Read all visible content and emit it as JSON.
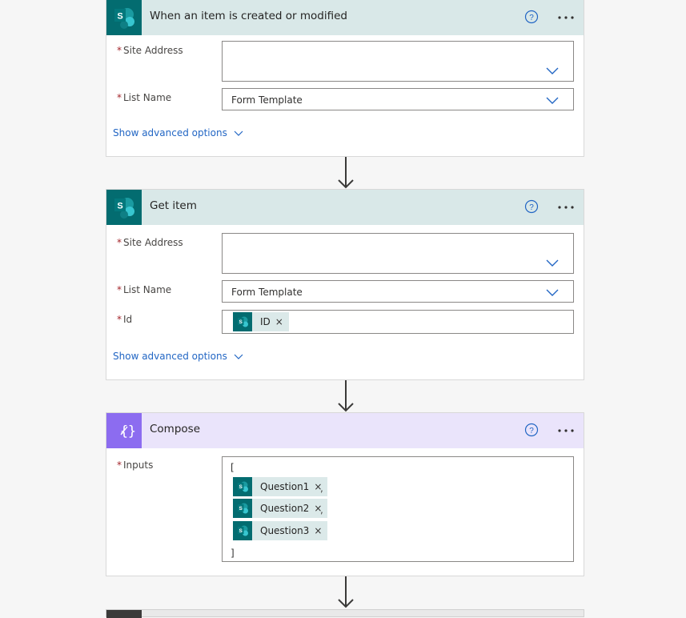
{
  "cards": [
    {
      "title": "When an item is created or modified",
      "fields": [
        {
          "label": "Site Address",
          "required_mark": "*",
          "value": ""
        },
        {
          "label": "List Name",
          "required_mark": "*",
          "value": "Form Template"
        }
      ],
      "advanced_label": "Show advanced options"
    },
    {
      "title": "Get item",
      "fields": [
        {
          "label": "Site Address",
          "required_mark": "*",
          "value": ""
        },
        {
          "label": "List Name",
          "required_mark": "*",
          "value": "Form Template"
        },
        {
          "label": "Id",
          "required_mark": "*",
          "token": "ID"
        }
      ],
      "advanced_label": "Show advanced options"
    },
    {
      "title": "Compose",
      "fields": [
        {
          "label": "Inputs",
          "required_mark": "*"
        }
      ],
      "inputs": {
        "open_bracket": "[",
        "tokens": [
          "Question1",
          "Question2",
          "Question3"
        ],
        "separator": ",",
        "close_bracket": "]"
      }
    }
  ],
  "icons": {
    "sharepoint": "sharepoint-icon",
    "compose": "compose-icon",
    "help": "help-icon",
    "more": "more-options-icon",
    "chevron": "chevron-down-icon",
    "remove": "×",
    "arrow": "arrow-down-icon"
  },
  "colors": {
    "sharepoint": "#036c70",
    "sharepoint_header": "#d9e8e8",
    "compose": "#8c6cf0",
    "compose_header": "#eae4fb",
    "link": "#2266c4",
    "required": "#a4262c"
  }
}
